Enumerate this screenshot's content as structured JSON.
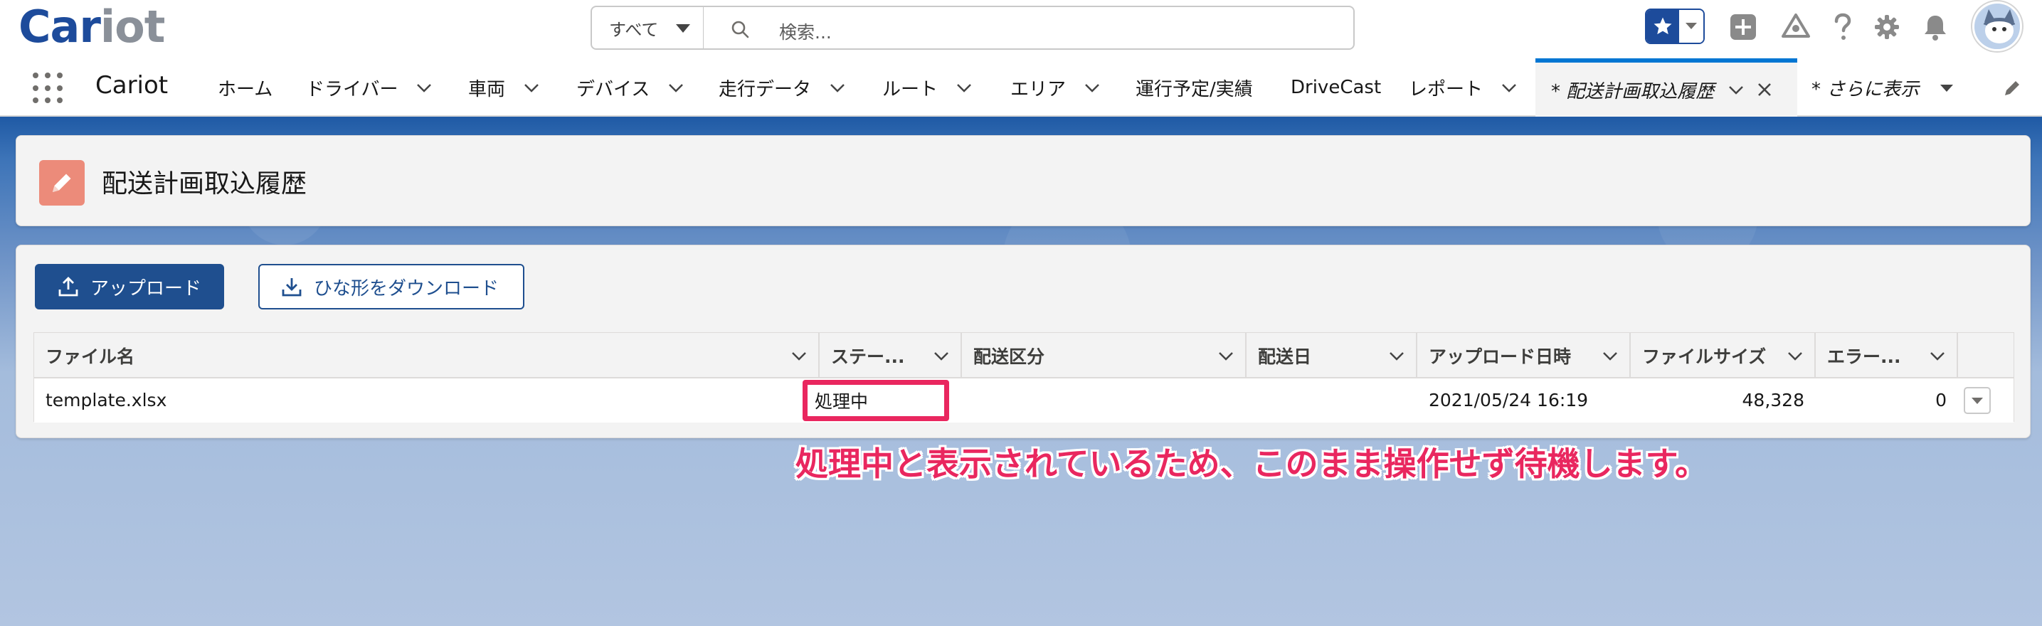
{
  "header": {
    "logo_primary": "Car",
    "logo_secondary": "iot",
    "search_scope": "すべて",
    "search_placeholder": "検索...",
    "icons": [
      "favorites-star-icon",
      "add-icon",
      "trailhead-icon",
      "help-icon",
      "setup-gear-icon",
      "notifications-bell-icon",
      "avatar"
    ]
  },
  "nav": {
    "app_name": "Cariot",
    "items": [
      {
        "label": "ホーム",
        "has_menu": false
      },
      {
        "label": "ドライバー",
        "has_menu": true
      },
      {
        "label": "車両",
        "has_menu": true
      },
      {
        "label": "デバイス",
        "has_menu": true
      },
      {
        "label": "走行データ",
        "has_menu": true
      },
      {
        "label": "ルート",
        "has_menu": true
      },
      {
        "label": "エリア",
        "has_menu": true
      },
      {
        "label": "運行予定/実績",
        "has_menu": false
      },
      {
        "label": "DriveCast",
        "has_menu": false
      },
      {
        "label": "レポート",
        "has_menu": true
      }
    ],
    "active_tab": "* 配送計画取込履歴",
    "more_label": "* さらに表示"
  },
  "page": {
    "title": "配送計画取込履歴",
    "upload_button": "アップロード",
    "template_download_button": "ひな形をダウンロード"
  },
  "table": {
    "columns": [
      "ファイル名",
      "ステー...",
      "配送区分",
      "配送日",
      "アップロード日時",
      "ファイルサイズ",
      "エラー..."
    ],
    "rows": [
      {
        "file_name": "template.xlsx",
        "status": "処理中",
        "delivery_type": "",
        "delivery_date": "",
        "uploaded_at": "2021/05/24 16:19",
        "file_size": "48,328",
        "errors": "0"
      }
    ]
  },
  "annotation": "処理中と表示されているため、このまま操作せず待機します。",
  "colors": {
    "brand_blue": "#1d4b9b",
    "accent_blue": "#0176d3",
    "highlight_pink": "#e9275f",
    "page_icon": "#ec8b7a"
  }
}
